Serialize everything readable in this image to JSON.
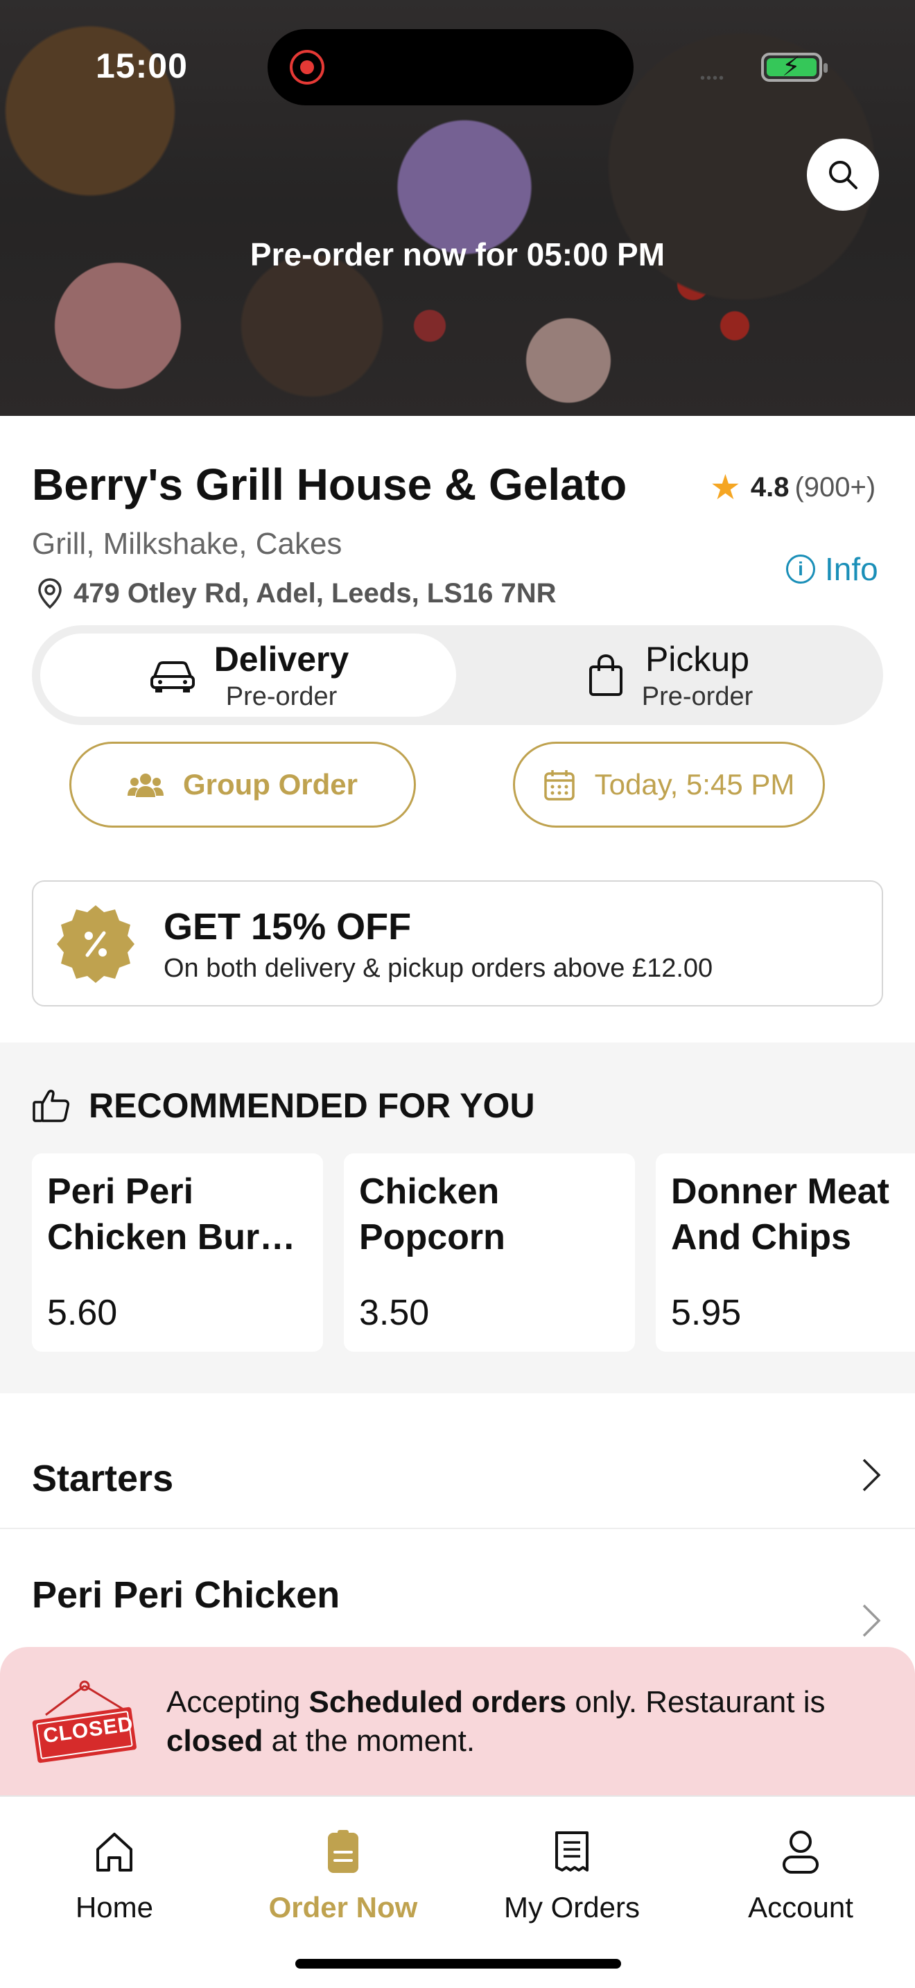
{
  "status_bar": {
    "time": "15:00"
  },
  "hero": {
    "preorder_text": "Pre-order now for 05:00 PM",
    "search_icon": "search-icon"
  },
  "restaurant": {
    "name": "Berry's Grill House & Gelato",
    "rating": "4.8",
    "rating_count": "(900+)",
    "cuisine": "Grill, Milkshake, Cakes",
    "address": "479 Otley Rd, Adel, Leeds, LS16 7NR",
    "info_label": "Info"
  },
  "order_mode": {
    "selected": "Delivery",
    "options": [
      {
        "label": "Delivery",
        "sub": "Pre-order",
        "icon": "car-icon"
      },
      {
        "label": "Pickup",
        "sub": "Pre-order",
        "icon": "shopping-bag-icon"
      }
    ]
  },
  "actions": {
    "group_order": "Group Order",
    "schedule": "Today, 5:45 PM"
  },
  "promo": {
    "title": "GET 15% OFF",
    "subtitle": "On both delivery & pickup orders above £12.00",
    "accent": "#bfa24f"
  },
  "recommended": {
    "title": "RECOMMENDED FOR YOU",
    "items": [
      {
        "name": "Peri Peri Chicken Bur…",
        "price": "5.60"
      },
      {
        "name": "Chicken Popcorn",
        "price": "3.50"
      },
      {
        "name": "Donner Meat And Chips",
        "price": "5.95"
      }
    ]
  },
  "categories": [
    {
      "label": "Starters"
    },
    {
      "label": "Peri Peri Chicken"
    }
  ],
  "closed_notice": {
    "sign_text": "CLOSED",
    "pre": "Accepting ",
    "bold1": "Scheduled orders",
    "mid": " only. Restaurant is",
    "bold2": "closed",
    "post": " at the moment.",
    "bg_color": "#f8d7da"
  },
  "tabbar": {
    "active": "Order Now",
    "tabs": [
      {
        "label": "Home",
        "icon": "home-icon"
      },
      {
        "label": "Order Now",
        "icon": "order-icon"
      },
      {
        "label": "My Orders",
        "icon": "receipt-icon"
      },
      {
        "label": "Account",
        "icon": "user-icon"
      }
    ]
  }
}
